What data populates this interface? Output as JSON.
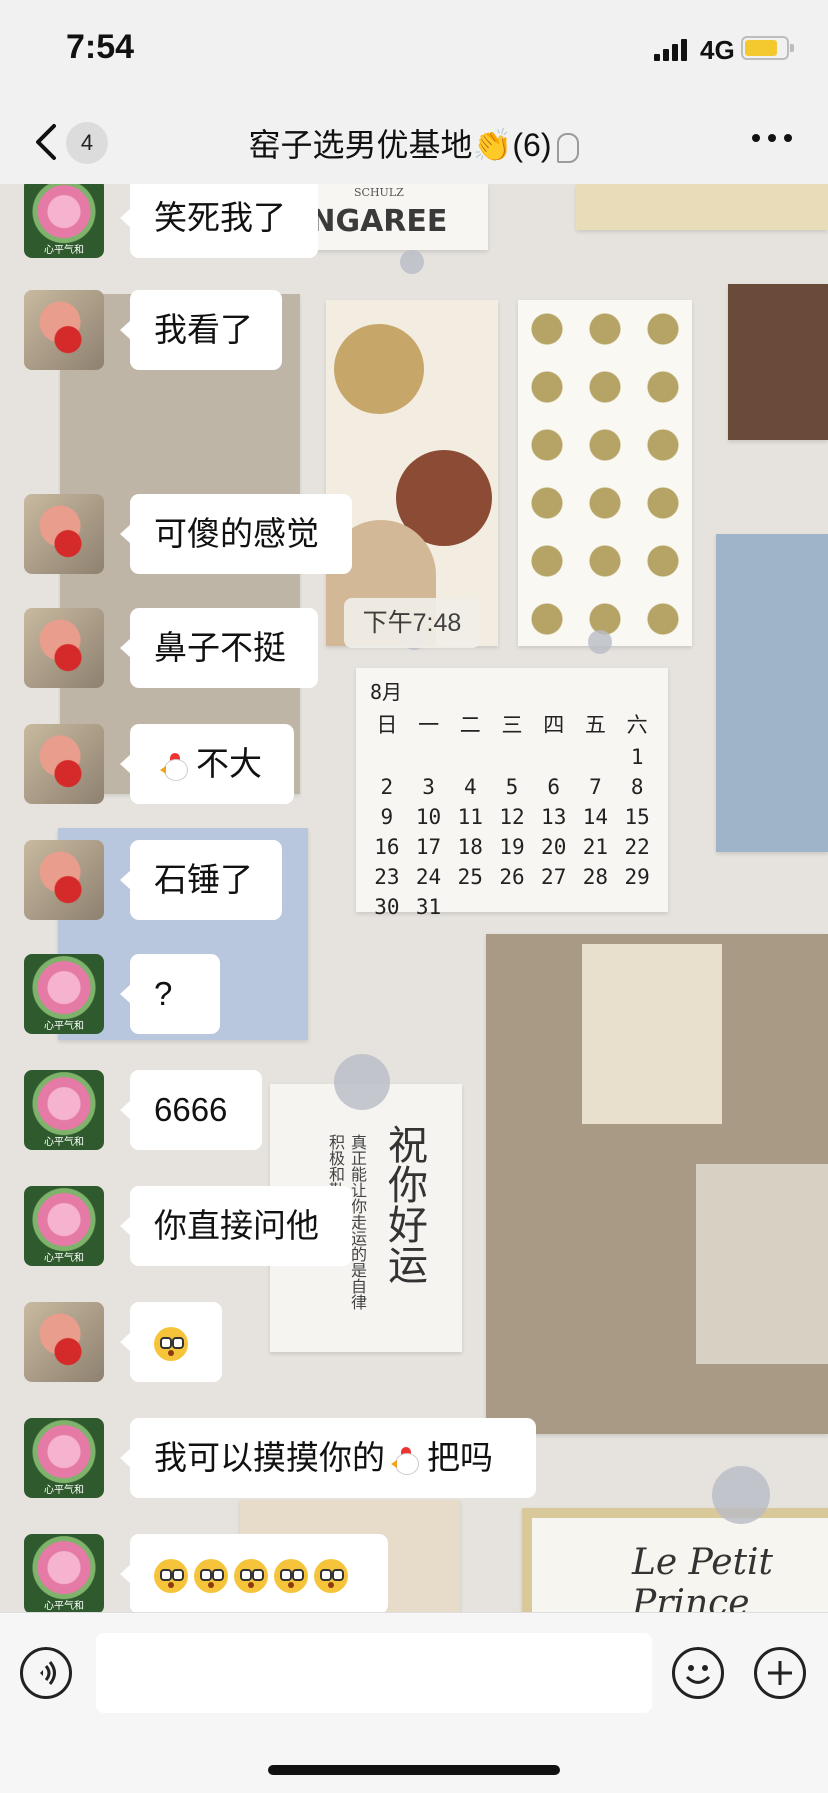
{
  "status_bar": {
    "time": "7:54",
    "network": "4G"
  },
  "header": {
    "back_count": "4",
    "title": "窑子选男优基地👏(6)"
  },
  "timestamp": "下午7:48",
  "wallpaper": {
    "dungaree": "UNGAREE",
    "dungaree_small": "SCHULZ",
    "calendar_month": "8月",
    "calendar_weekdays": [
      "日",
      "一",
      "二",
      "三",
      "四",
      "五",
      "六"
    ],
    "calendar_days": [
      "",
      "",
      "",
      "",
      "",
      "",
      "1",
      "2",
      "3",
      "4",
      "5",
      "6",
      "7",
      "8",
      "9",
      "10",
      "11",
      "12",
      "13",
      "14",
      "15",
      "16",
      "17",
      "18",
      "19",
      "20",
      "21",
      "22",
      "23",
      "24",
      "25",
      "26",
      "27",
      "28",
      "29",
      "30",
      "31"
    ],
    "luck_big": "祝你好运",
    "luck_small": "真正能让你走运的是自律积极和勤奋。",
    "prince": "Le Petit Prince"
  },
  "messages": [
    {
      "avatar": "lotus",
      "avatar_caption": "心平气和",
      "text": "笑死我了"
    },
    {
      "avatar": "doll",
      "text": "我看了"
    },
    {
      "avatar": "doll",
      "text": "可傻的感觉"
    },
    {
      "avatar": "doll",
      "text": "鼻子不挺"
    },
    {
      "avatar": "doll",
      "text": "不大",
      "leading_icon": "chicken-emoji"
    },
    {
      "avatar": "doll",
      "text": "石锤了"
    },
    {
      "avatar": "lotus",
      "avatar_caption": "心平气和",
      "text": "?"
    },
    {
      "avatar": "lotus",
      "avatar_caption": "心平气和",
      "text": "6666"
    },
    {
      "avatar": "lotus",
      "avatar_caption": "心平气和",
      "text": "你直接问他"
    },
    {
      "avatar": "doll",
      "text": "",
      "emoji": "confused-face-emoji"
    },
    {
      "avatar": "lotus",
      "avatar_caption": "心平气和",
      "text_before": "我可以摸摸你的",
      "text_after": "把吗",
      "inline_icon": "chicken-emoji"
    },
    {
      "avatar": "lotus",
      "avatar_caption": "心平气和",
      "text": "",
      "emoji": "confused-face-emoji",
      "emoji_count": 5
    }
  ],
  "input": {
    "placeholder": ""
  },
  "colors": {
    "battery": "#f4c92f",
    "bubble": "#ffffff",
    "chat_background": "#e6e3de"
  }
}
